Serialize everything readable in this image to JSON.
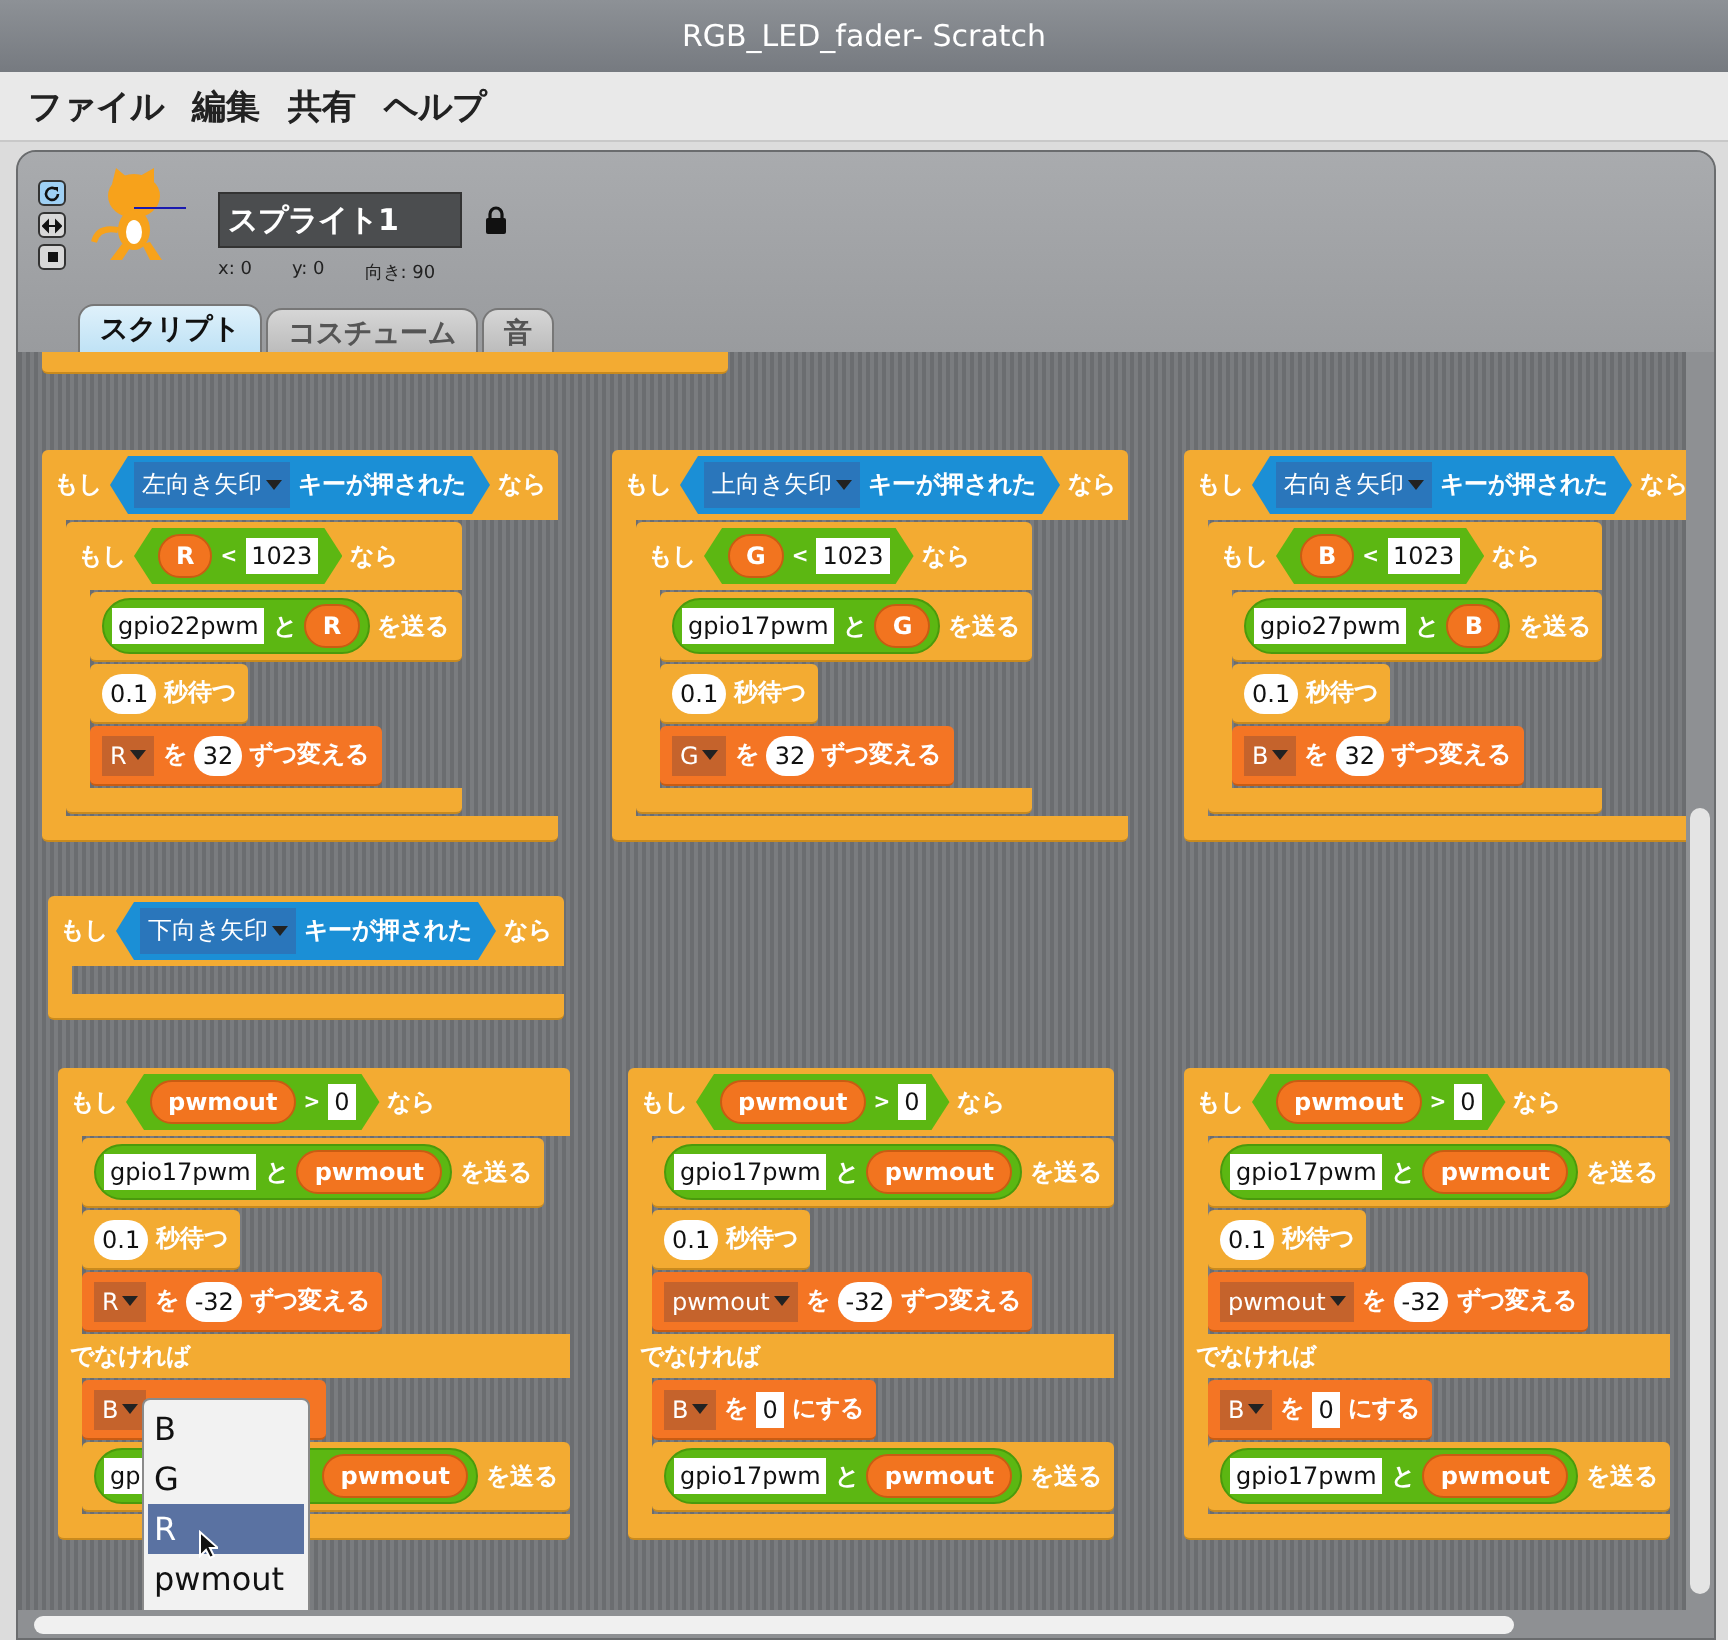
{
  "window": {
    "title": "RGB_LED_fader- Scratch"
  },
  "menu_bar": [
    {
      "label": "ファイル"
    },
    {
      "label": "編集"
    },
    {
      "label": "共有"
    },
    {
      "label": "ヘルプ"
    }
  ],
  "sprite": {
    "name": "スプライト1",
    "x": "x: 0",
    "y": "y: 0",
    "direction": "向き: 90",
    "rotation_styles": [
      {
        "kind": "rotate",
        "selected": true
      },
      {
        "kind": "flip",
        "selected": false
      },
      {
        "kind": "none",
        "selected": false
      }
    ]
  },
  "tabs": [
    {
      "label": "スクリプト",
      "selected": true
    },
    {
      "label": "コスチューム",
      "selected": false
    },
    {
      "label": "音",
      "selected": false
    }
  ],
  "scripts": [
    {
      "kind": "c",
      "segments": [
        {
          "kind": "label",
          "text": "もし"
        },
        {
          "kind": "sensor",
          "parts": [
            {
              "kind": "key_menu",
              "text": "左向き矢印"
            },
            {
              "kind": "label",
              "text": "キーが押された"
            }
          ]
        },
        {
          "kind": "label",
          "text": "なら"
        }
      ],
      "body": [
        {
          "kind": "c",
          "segments": [
            {
              "kind": "label",
              "text": "もし"
            },
            {
              "kind": "bool",
              "parts": [
                {
                  "kind": "var",
                  "text": "R"
                },
                {
                  "kind": "op",
                  "text": "<"
                },
                {
                  "kind": "field",
                  "text": "1023"
                }
              ]
            },
            {
              "kind": "label",
              "text": "なら"
            }
          ],
          "body": [
            {
              "kind": "stack",
              "segments": [
                {
                  "kind": "reporter",
                  "parts": [
                    {
                      "kind": "field",
                      "text": "gpio22pwm"
                    },
                    {
                      "kind": "label",
                      "text": "と"
                    },
                    {
                      "kind": "var",
                      "text": "R"
                    }
                  ]
                },
                {
                  "kind": "label",
                  "text": "を送る"
                }
              ]
            },
            {
              "kind": "stack",
              "segments": [
                {
                  "kind": "round",
                  "text": "0.1"
                },
                {
                  "kind": "label",
                  "text": "秒待つ"
                }
              ]
            },
            {
              "kind": "data_stack",
              "segments": [
                {
                  "kind": "menu",
                  "text": "R"
                },
                {
                  "kind": "label",
                  "text": "を"
                },
                {
                  "kind": "round",
                  "text": "32"
                },
                {
                  "kind": "label",
                  "text": "ずつ変える"
                }
              ]
            }
          ]
        }
      ]
    },
    {
      "kind": "c",
      "segments": [
        {
          "kind": "label",
          "text": "もし"
        },
        {
          "kind": "sensor",
          "parts": [
            {
              "kind": "key_menu",
              "text": "上向き矢印"
            },
            {
              "kind": "label",
              "text": "キーが押された"
            }
          ]
        },
        {
          "kind": "label",
          "text": "なら"
        }
      ],
      "body": [
        {
          "kind": "c",
          "segments": [
            {
              "kind": "label",
              "text": "もし"
            },
            {
              "kind": "bool",
              "parts": [
                {
                  "kind": "var",
                  "text": "G"
                },
                {
                  "kind": "op",
                  "text": "<"
                },
                {
                  "kind": "field",
                  "text": "1023"
                }
              ]
            },
            {
              "kind": "label",
              "text": "なら"
            }
          ],
          "body": [
            {
              "kind": "stack",
              "segments": [
                {
                  "kind": "reporter",
                  "parts": [
                    {
                      "kind": "field",
                      "text": "gpio17pwm"
                    },
                    {
                      "kind": "label",
                      "text": "と"
                    },
                    {
                      "kind": "var",
                      "text": "G"
                    }
                  ]
                },
                {
                  "kind": "label",
                  "text": "を送る"
                }
              ]
            },
            {
              "kind": "stack",
              "segments": [
                {
                  "kind": "round",
                  "text": "0.1"
                },
                {
                  "kind": "label",
                  "text": "秒待つ"
                }
              ]
            },
            {
              "kind": "data_stack",
              "segments": [
                {
                  "kind": "menu",
                  "text": "G"
                },
                {
                  "kind": "label",
                  "text": "を"
                },
                {
                  "kind": "round",
                  "text": "32"
                },
                {
                  "kind": "label",
                  "text": "ずつ変える"
                }
              ]
            }
          ]
        }
      ]
    },
    {
      "kind": "c",
      "segments": [
        {
          "kind": "label",
          "text": "もし"
        },
        {
          "kind": "sensor",
          "parts": [
            {
              "kind": "key_menu",
              "text": "右向き矢印"
            },
            {
              "kind": "label",
              "text": "キーが押された"
            }
          ]
        },
        {
          "kind": "label",
          "text": "なら"
        }
      ],
      "body": [
        {
          "kind": "c",
          "segments": [
            {
              "kind": "label",
              "text": "もし"
            },
            {
              "kind": "bool",
              "parts": [
                {
                  "kind": "var",
                  "text": "B"
                },
                {
                  "kind": "op",
                  "text": "<"
                },
                {
                  "kind": "field",
                  "text": "1023"
                }
              ]
            },
            {
              "kind": "label",
              "text": "なら"
            }
          ],
          "body": [
            {
              "kind": "stack",
              "segments": [
                {
                  "kind": "reporter",
                  "parts": [
                    {
                      "kind": "field",
                      "text": "gpio27pwm"
                    },
                    {
                      "kind": "label",
                      "text": "と"
                    },
                    {
                      "kind": "var",
                      "text": "B"
                    }
                  ]
                },
                {
                  "kind": "label",
                  "text": "を送る"
                }
              ]
            },
            {
              "kind": "stack",
              "segments": [
                {
                  "kind": "round",
                  "text": "0.1"
                },
                {
                  "kind": "label",
                  "text": "秒待つ"
                }
              ]
            },
            {
              "kind": "data_stack",
              "segments": [
                {
                  "kind": "menu",
                  "text": "B"
                },
                {
                  "kind": "label",
                  "text": "を"
                },
                {
                  "kind": "round",
                  "text": "32"
                },
                {
                  "kind": "label",
                  "text": "ずつ変える"
                }
              ]
            }
          ]
        }
      ]
    },
    {
      "kind": "c",
      "segments": [
        {
          "kind": "label",
          "text": "もし"
        },
        {
          "kind": "sensor",
          "parts": [
            {
              "kind": "key_menu",
              "text": "下向き矢印"
            },
            {
              "kind": "label",
              "text": "キーが押された"
            }
          ]
        },
        {
          "kind": "label",
          "text": "なら"
        }
      ]
    },
    {
      "kind": "c_else",
      "segments": [
        {
          "kind": "label",
          "text": "もし"
        },
        {
          "kind": "bool",
          "parts": [
            {
              "kind": "var",
              "text": "pwmout"
            },
            {
              "kind": "op",
              "text": ">"
            },
            {
              "kind": "field",
              "text": "0"
            }
          ]
        },
        {
          "kind": "label",
          "text": "なら"
        }
      ],
      "body": [
        {
          "kind": "stack",
          "segments": [
            {
              "kind": "reporter",
              "parts": [
                {
                  "kind": "field",
                  "text": "gpio17pwm"
                },
                {
                  "kind": "label",
                  "text": "と"
                },
                {
                  "kind": "var",
                  "text": "pwmout"
                }
              ]
            },
            {
              "kind": "label",
              "text": "を送る"
            }
          ]
        },
        {
          "kind": "stack",
          "segments": [
            {
              "kind": "round",
              "text": "0.1"
            },
            {
              "kind": "label",
              "text": "秒待つ"
            }
          ]
        },
        {
          "kind": "data_stack",
          "segments": [
            {
              "kind": "menu",
              "text": "R"
            },
            {
              "kind": "label",
              "text": "を"
            },
            {
              "kind": "round",
              "text": "-32"
            },
            {
              "kind": "label",
              "text": "ずつ変える"
            }
          ]
        }
      ],
      "else_label": "でなければ",
      "else_body": [
        {
          "kind": "data_stack",
          "segments": [
            {
              "kind": "menu",
              "text": "B"
            },
            {
              "kind": "covered"
            }
          ]
        },
        {
          "kind": "stack",
          "segments": [
            {
              "kind": "reporter",
              "parts": [
                {
                  "kind": "field",
                  "text": "gp"
                },
                {
                  "kind": "covered"
                },
                {
                  "kind": "var",
                  "text": "pwmout"
                }
              ]
            },
            {
              "kind": "label",
              "text": "を送る"
            }
          ]
        }
      ]
    },
    {
      "kind": "c_else",
      "segments": [
        {
          "kind": "label",
          "text": "もし"
        },
        {
          "kind": "bool",
          "parts": [
            {
              "kind": "var",
              "text": "pwmout"
            },
            {
              "kind": "op",
              "text": ">"
            },
            {
              "kind": "field",
              "text": "0"
            }
          ]
        },
        {
          "kind": "label",
          "text": "なら"
        }
      ],
      "body": [
        {
          "kind": "stack",
          "segments": [
            {
              "kind": "reporter",
              "parts": [
                {
                  "kind": "field",
                  "text": "gpio17pwm"
                },
                {
                  "kind": "label",
                  "text": "と"
                },
                {
                  "kind": "var",
                  "text": "pwmout"
                }
              ]
            },
            {
              "kind": "label",
              "text": "を送る"
            }
          ]
        },
        {
          "kind": "stack",
          "segments": [
            {
              "kind": "round",
              "text": "0.1"
            },
            {
              "kind": "label",
              "text": "秒待つ"
            }
          ]
        },
        {
          "kind": "data_stack",
          "segments": [
            {
              "kind": "menu",
              "text": "pwmout"
            },
            {
              "kind": "label",
              "text": "を"
            },
            {
              "kind": "round",
              "text": "-32"
            },
            {
              "kind": "label",
              "text": "ずつ変える"
            }
          ]
        }
      ],
      "else_label": "でなければ",
      "else_body": [
        {
          "kind": "data_stack",
          "segments": [
            {
              "kind": "menu",
              "text": "B"
            },
            {
              "kind": "label",
              "text": "を"
            },
            {
              "kind": "field",
              "text": "0"
            },
            {
              "kind": "label",
              "text": "にする"
            }
          ]
        },
        {
          "kind": "stack",
          "segments": [
            {
              "kind": "reporter",
              "parts": [
                {
                  "kind": "field",
                  "text": "gpio17pwm"
                },
                {
                  "kind": "label",
                  "text": "と"
                },
                {
                  "kind": "var",
                  "text": "pwmout"
                }
              ]
            },
            {
              "kind": "label",
              "text": "を送る"
            }
          ]
        }
      ]
    },
    {
      "kind": "c_else",
      "segments": [
        {
          "kind": "label",
          "text": "もし"
        },
        {
          "kind": "bool",
          "parts": [
            {
              "kind": "var",
              "text": "pwmout"
            },
            {
              "kind": "op",
              "text": ">"
            },
            {
              "kind": "field",
              "text": "0"
            }
          ]
        },
        {
          "kind": "label",
          "text": "なら"
        }
      ],
      "body": [
        {
          "kind": "stack",
          "segments": [
            {
              "kind": "reporter",
              "parts": [
                {
                  "kind": "field",
                  "text": "gpio17pwm"
                },
                {
                  "kind": "label",
                  "text": "と"
                },
                {
                  "kind": "var",
                  "text": "pwmout"
                }
              ]
            },
            {
              "kind": "label",
              "text": "を送る"
            }
          ]
        },
        {
          "kind": "stack",
          "segments": [
            {
              "kind": "round",
              "text": "0.1"
            },
            {
              "kind": "label",
              "text": "秒待つ"
            }
          ]
        },
        {
          "kind": "data_stack",
          "segments": [
            {
              "kind": "menu",
              "text": "pwmout"
            },
            {
              "kind": "label",
              "text": "を"
            },
            {
              "kind": "round",
              "text": "-32"
            },
            {
              "kind": "label",
              "text": "ずつ変える"
            }
          ]
        }
      ],
      "else_label": "でなければ",
      "else_body": [
        {
          "kind": "data_stack",
          "segments": [
            {
              "kind": "menu",
              "text": "B"
            },
            {
              "kind": "label",
              "text": "を"
            },
            {
              "kind": "field",
              "text": "0"
            },
            {
              "kind": "label",
              "text": "にする"
            }
          ]
        },
        {
          "kind": "stack",
          "segments": [
            {
              "kind": "reporter",
              "parts": [
                {
                  "kind": "field",
                  "text": "gpio17pwm"
                },
                {
                  "kind": "label",
                  "text": "と"
                },
                {
                  "kind": "var",
                  "text": "pwmout"
                }
              ]
            },
            {
              "kind": "label",
              "text": "を送る"
            }
          ]
        }
      ]
    }
  ],
  "dropdown": {
    "items": [
      {
        "label": "B",
        "selected": false
      },
      {
        "label": "G",
        "selected": false
      },
      {
        "label": "R",
        "selected": true
      },
      {
        "label": "pwmout",
        "selected": false
      }
    ]
  }
}
